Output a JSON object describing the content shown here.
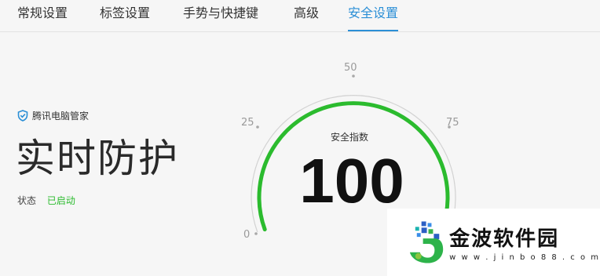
{
  "tabs": [
    {
      "label": "常规设置",
      "active": false
    },
    {
      "label": "标签设置",
      "active": false
    },
    {
      "label": "手势与快捷键",
      "active": false
    },
    {
      "label": "高级",
      "active": false
    },
    {
      "label": "安全设置",
      "active": true
    }
  ],
  "protection": {
    "brand": "腾讯电脑管家",
    "title": "实时防护",
    "status_label": "状态",
    "status_value": "已启动"
  },
  "gauge": {
    "caption": "安全指数",
    "score": "100",
    "value": 100,
    "tick_labels": [
      "0",
      "25",
      "50",
      "75"
    ],
    "arc_color": "#2bbb2e"
  },
  "watermark": {
    "name": "金波软件园",
    "url": "w w w . j i n b o 8 8 . c o m"
  },
  "colors": {
    "accent": "#2b8fd6",
    "status_green": "#2bbb2e"
  }
}
